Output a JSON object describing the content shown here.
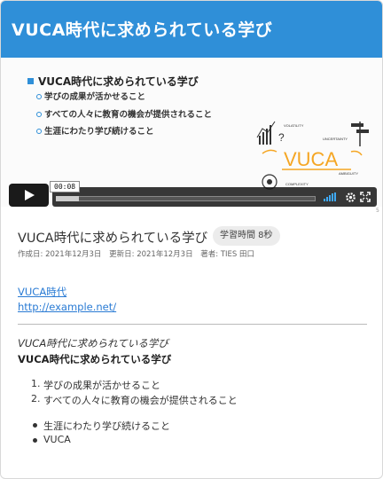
{
  "video": {
    "slide_title": "VUCA時代に求められている学び",
    "slide_heading": "VUCA時代に求められている学び",
    "slide_items": [
      "学びの成果が活かせること",
      "すべての人々に教育の機会が提供されること",
      "生涯にわたり学び続けること"
    ],
    "art": {
      "center": "VUCA",
      "volatility": "VOLATILITY",
      "uncertainty": "UNCERTAINTY",
      "complexity": "COMPLEXITY",
      "ambiguity": "AMBIGUITY"
    },
    "current_time": "00:08",
    "page_marker": "5",
    "progress_fraction": 0.09
  },
  "lesson": {
    "title": "VUCA時代に求められている学び",
    "duration_badge": "学習時間 8秒",
    "created": "作成日: 2021年12月3日",
    "updated": "更新日: 2021年12月3日",
    "author": "著者: TIES 田口"
  },
  "links": [
    "VUCA時代",
    "http://example.net/"
  ],
  "content": {
    "italic_text": "VUCA時代に求められている学び",
    "bold_text": "VUCA時代に求められている学び",
    "ordered": [
      "学びの成果が活かせること",
      "すべての人々に教育の機会が提供されること"
    ],
    "bullets": [
      "生涯にわたり学び続けること",
      "VUCA"
    ]
  },
  "colors": {
    "banner": "#2f8fd8",
    "link": "#2a7bd4",
    "vuca_orange": "#f5a623"
  }
}
